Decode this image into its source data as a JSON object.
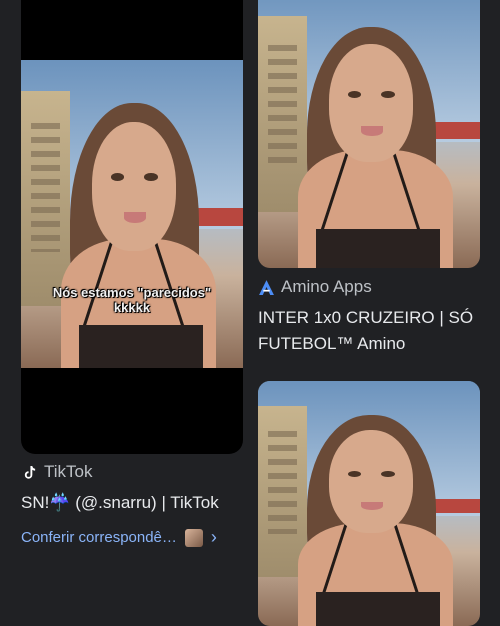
{
  "left_result": {
    "video_caption_line1": "Nós estamos \"parecidos\"",
    "video_caption_line2": "kkkkk",
    "source_name": "TikTok",
    "title": "SN!☔ (@.snarru) | TikTok",
    "action_link": "Conferir correspondê…",
    "source_icon": "tiktok-icon",
    "chevron_icon": "chevron-right-icon"
  },
  "right_result_1": {
    "source_name": "Amino Apps",
    "title_line1": "INTER 1x0 CRUZEIRO | SÓ",
    "title_line2": "FUTEBOL™ Amino",
    "source_icon": "amino-icon"
  },
  "colors": {
    "background": "#202124",
    "text_primary": "#e8eaed",
    "text_secondary": "#bdc1c6",
    "link": "#8ab4f8"
  }
}
